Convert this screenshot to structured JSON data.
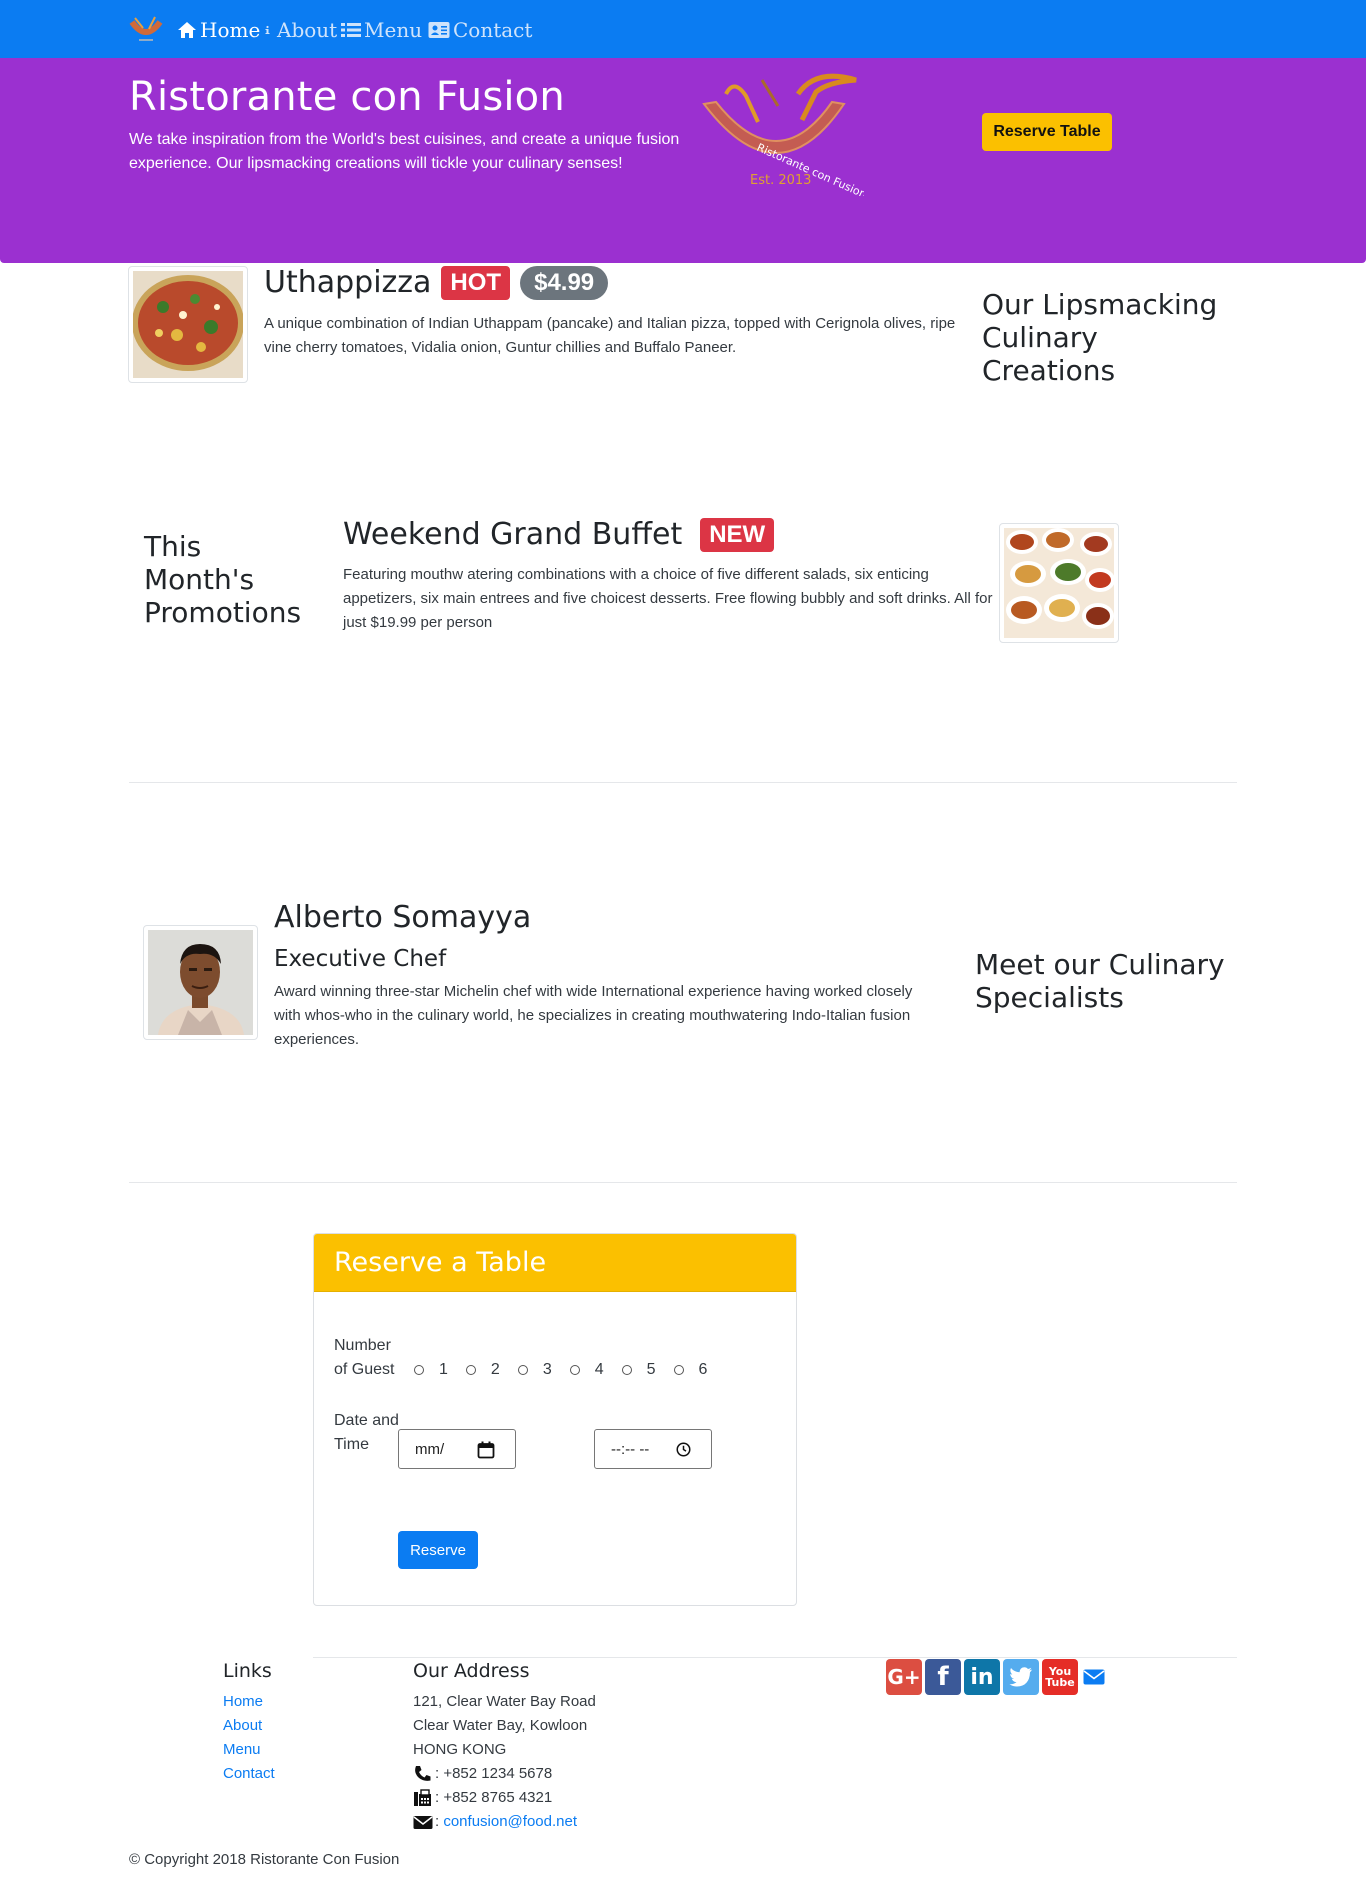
{
  "nav": {
    "items": [
      {
        "label": "Home",
        "icon": "home-icon"
      },
      {
        "label": "About",
        "icon": "info-icon"
      },
      {
        "label": "Menu",
        "icon": "list-icon"
      },
      {
        "label": "Contact",
        "icon": "address-card-icon"
      }
    ]
  },
  "jumbotron": {
    "title": "Ristorante con Fusion",
    "text": "We take inspiration from the World's best cuisines, and create a unique fusion experience. Our lipsmacking creations will tickle your culinary senses!",
    "logo_text": "Ristorante con Fusion",
    "logo_est": "Est. 2013",
    "reserve_button": "Reserve Table"
  },
  "dish": {
    "name": "Uthappizza",
    "badge": "HOT",
    "price": "$4.99",
    "description": "A unique combination of Indian Uthappam (pancake) and Italian pizza, topped with Cerignola olives, ripe vine cherry tomatoes, Vidalia onion, Guntur chillies and Buffalo Paneer.",
    "section_title": "Our Lipsmacking Culinary Creations"
  },
  "promotion": {
    "section_title": "This Month's Promotions",
    "name": "Weekend Grand Buffet",
    "badge": "NEW",
    "description": "Featuring mouthw atering combinations with a choice of five different salads, six enticing appetizers, six main entrees and five choicest desserts. Free flowing bubbly and soft drinks. All for just $19.99 per person"
  },
  "leader": {
    "name": "Alberto Somayya",
    "designation": "Executive Chef",
    "description": "Award winning three-star Michelin chef with wide International experience having worked closely with whos-who in the culinary world, he specializes in creating mouthwatering Indo-Italian fusion experiences.",
    "section_title": "Meet our Culinary Specialists"
  },
  "reserve": {
    "title": "Reserve a Table",
    "guests_label": "Number of Guest",
    "guest_options": [
      "1",
      "2",
      "3",
      "4",
      "5",
      "6"
    ],
    "datetime_label": "Date and Time",
    "date_placeholder": "mm/",
    "time_placeholder": "--:-- --",
    "submit": "Reserve"
  },
  "footer": {
    "links_title": "Links",
    "links": [
      "Home",
      "About",
      "Menu",
      "Contact"
    ],
    "address_title": "Our Address",
    "address_lines": [
      "121, Clear Water Bay Road",
      "Clear Water Bay, Kowloon",
      "HONG KONG"
    ],
    "phone": ": +852 1234 5678",
    "fax": ": +852 8765 4321",
    "email_sep": ": ",
    "email": "confusion@food.net",
    "social": [
      "google-plus-icon",
      "facebook-icon",
      "linkedin-icon",
      "twitter-icon",
      "youtube-icon",
      "envelope-icon"
    ],
    "social_labels": {
      "youtube": "You\nTube"
    },
    "copyright": "© Copyright 2018 Ristorante Con Fusion"
  },
  "colors": {
    "navbar": "#0b7cf2",
    "jumbotron": "#9b30d0",
    "warning": "#fbc000",
    "danger": "#dc3545",
    "primary": "#0b7cf2"
  }
}
